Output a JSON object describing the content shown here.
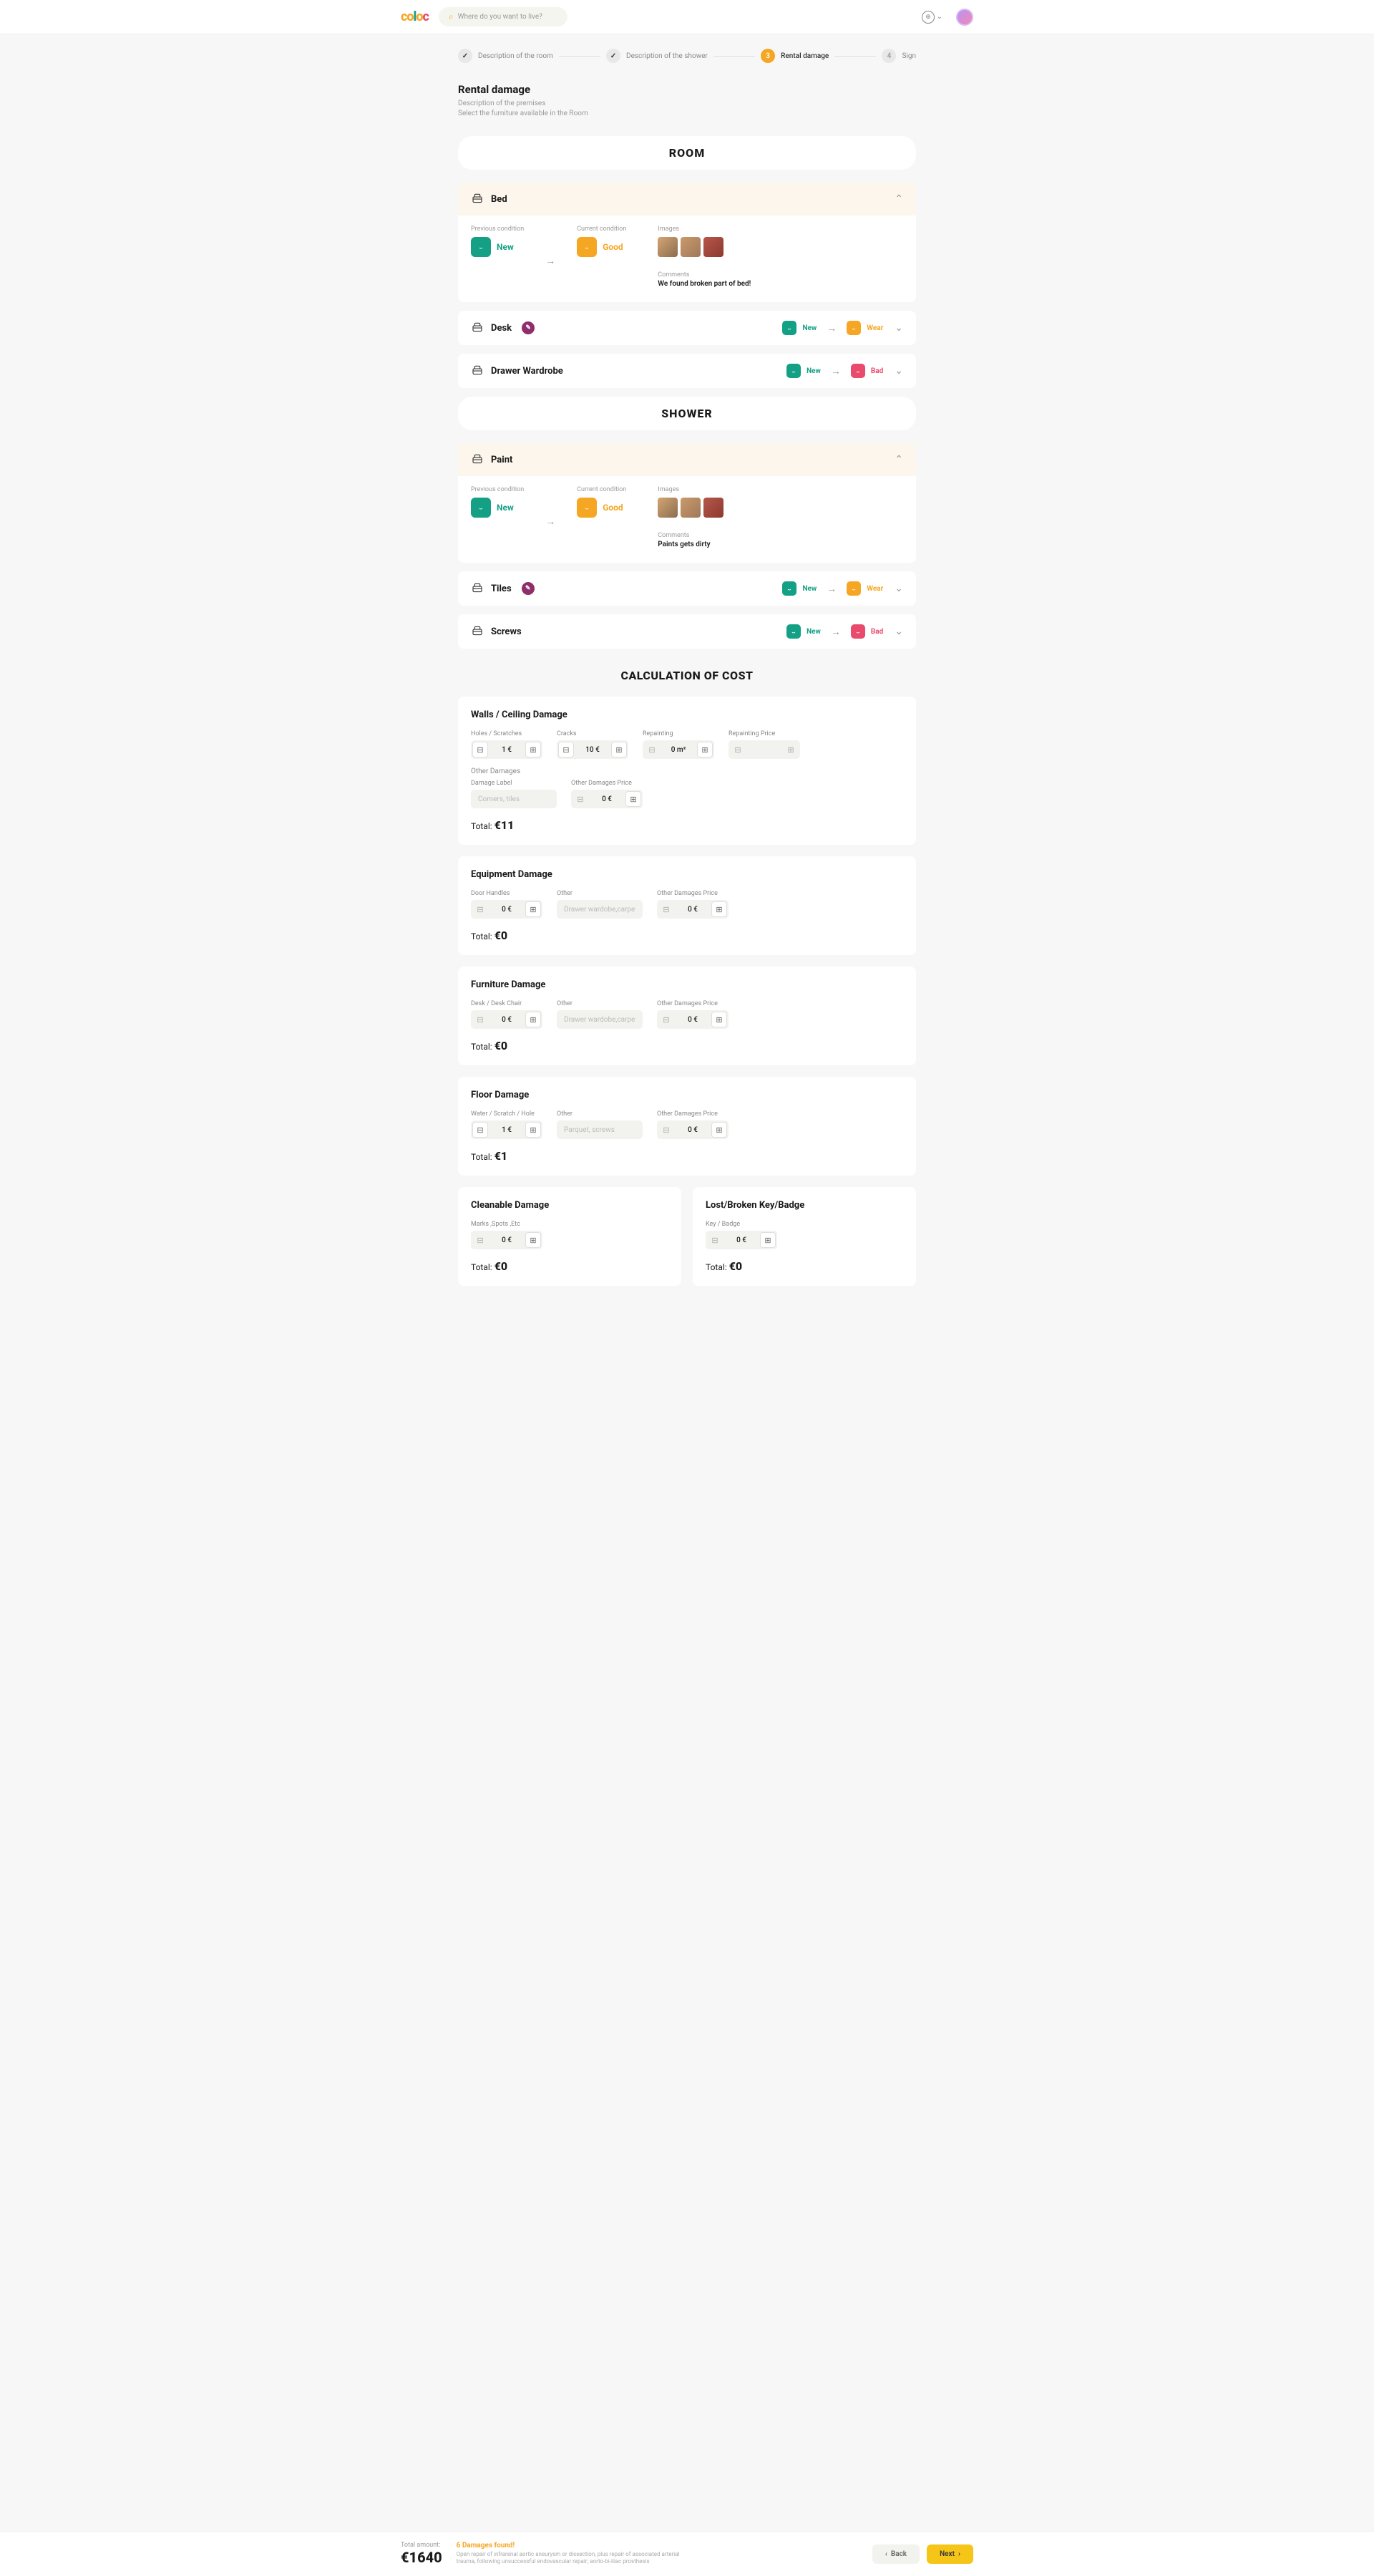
{
  "header": {
    "logo": "coloc",
    "search_placeholder": "Where do you want to live?"
  },
  "stepper": {
    "steps": [
      {
        "num": "✓",
        "label": "Description of the room",
        "state": "done"
      },
      {
        "num": "✓",
        "label": "Description of the shower",
        "state": "done"
      },
      {
        "num": "3",
        "label": "Rental damage",
        "state": "active"
      },
      {
        "num": "4",
        "label": "Sign",
        "state": "pending"
      }
    ]
  },
  "page": {
    "title": "Rental damage",
    "sub1": "Description of the premises",
    "sub2": "Select the furniture available in the Room"
  },
  "room": {
    "heading": "ROOM",
    "items": [
      {
        "name": "Bed",
        "expanded": true,
        "prev_label": "Previous condition",
        "prev": "New",
        "curr_label": "Current condition",
        "curr": "Good",
        "img_label": "Images",
        "comments_label": "Comments",
        "comment": "We found broken part of bed!"
      },
      {
        "name": "Desk",
        "expanded": false,
        "prev": "New",
        "curr": "Wear",
        "has_chip": true
      },
      {
        "name": "Drawer Wardrobe",
        "expanded": false,
        "prev": "New",
        "curr": "Bad"
      }
    ]
  },
  "shower": {
    "heading": "SHOWER",
    "items": [
      {
        "name": "Paint",
        "expanded": true,
        "prev_label": "Previous condition",
        "prev": "New",
        "curr_label": "Current condition",
        "curr": "Good",
        "img_label": "Images",
        "comments_label": "Comments",
        "comment": "Paints gets dirty"
      },
      {
        "name": "Tiles",
        "expanded": false,
        "prev": "New",
        "curr": "Wear",
        "has_chip": true
      },
      {
        "name": "Screws",
        "expanded": false,
        "prev": "New",
        "curr": "Bad"
      }
    ]
  },
  "calc": {
    "heading": "CALCULATION OF COST",
    "sections": [
      {
        "title": "Walls / Ceiling Damage",
        "fields": [
          {
            "label": "Holes / Scratches",
            "value": "1 €",
            "minus": true,
            "plus": true
          },
          {
            "label": "Cracks",
            "value": "10 €",
            "minus": true,
            "plus": true
          },
          {
            "label": "Repainting",
            "value": "0 m²",
            "minus": false,
            "plus": true
          },
          {
            "label": "Repainting Price",
            "value": "",
            "minus": false,
            "plus": false
          }
        ],
        "other_label": "Other Damages",
        "other_fields": [
          {
            "label": "Damage Label",
            "type": "text",
            "placeholder": "Corners, tiles"
          },
          {
            "label": "Other Damages Price",
            "value": "0 €",
            "minus": false,
            "plus": true
          }
        ],
        "total_label": "Total:",
        "total": "€11"
      },
      {
        "title": "Equipment Damage",
        "fields": [
          {
            "label": "Door Handles",
            "value": "0 €",
            "minus": false,
            "plus": true
          },
          {
            "label": "Other",
            "type": "text",
            "placeholder": "Drawer wardobe,carpet"
          },
          {
            "label": "Other Damages Price",
            "value": "0 €",
            "minus": false,
            "plus": true
          }
        ],
        "total_label": "Total:",
        "total": "€0"
      },
      {
        "title": "Furniture Damage",
        "fields": [
          {
            "label": "Desk / Desk Chair",
            "value": "0 €",
            "minus": false,
            "plus": true
          },
          {
            "label": "Other",
            "type": "text",
            "placeholder": "Drawer wardobe,carpet"
          },
          {
            "label": "Other Damages Price",
            "value": "0 €",
            "minus": false,
            "plus": true
          }
        ],
        "total_label": "Total:",
        "total": "€0"
      },
      {
        "title": "Floor Damage",
        "fields": [
          {
            "label": "Water / Scratch / Hole",
            "value": "1 €",
            "minus": true,
            "plus": true
          },
          {
            "label": "Other",
            "type": "text",
            "placeholder": "Parquet, screws"
          },
          {
            "label": "Other Damages Price",
            "value": "0 €",
            "minus": false,
            "plus": true
          }
        ],
        "total_label": "Total:",
        "total": "€1"
      }
    ],
    "pair": [
      {
        "title": "Cleanable Damage",
        "fields": [
          {
            "label": "Marks ,Spots ,Etc",
            "value": "0 €",
            "minus": false,
            "plus": true
          }
        ],
        "total_label": "Total:",
        "total": "€0"
      },
      {
        "title": "Lost/Broken Key/Badge",
        "fields": [
          {
            "label": "Key / Badge",
            "value": "0 €",
            "minus": false,
            "plus": true
          }
        ],
        "total_label": "Total:",
        "total": "€0"
      }
    ]
  },
  "footer": {
    "total_label": "Total amount:",
    "total_value": "€1640",
    "damage_title": "6 Damages found!",
    "damage_desc": "Open repair of infrarenal aortic aneurysm or dissection, plus repair of associated arterial trauma, following unsuccessful endovascular repair; aorto-bi-iliac prosthesis",
    "back": "Back",
    "next": "Next"
  }
}
